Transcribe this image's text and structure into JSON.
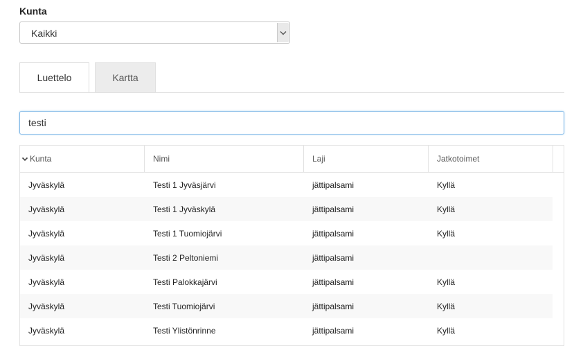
{
  "filter": {
    "label": "Kunta",
    "selected": "Kaikki"
  },
  "tabs": [
    {
      "label": "Luettelo",
      "active": true
    },
    {
      "label": "Kartta",
      "active": false
    }
  ],
  "search": {
    "value": "testi"
  },
  "table": {
    "columns": [
      "Kunta",
      "Nimi",
      "Laji",
      "Jatkotoimet"
    ],
    "rows": [
      [
        "Jyväskylä",
        "Testi 1 Jyväsjärvi",
        "jättipalsami",
        "Kyllä"
      ],
      [
        "Jyväskylä",
        "Testi 1 Jyväskylä",
        "jättipalsami",
        "Kyllä"
      ],
      [
        "Jyväskylä",
        "Testi 1 Tuomiojärvi",
        "jättipalsami",
        "Kyllä"
      ],
      [
        "Jyväskylä",
        "Testi 2 Peltoniemi",
        "jättipalsami",
        ""
      ],
      [
        "Jyväskylä",
        "Testi Palokkajärvi",
        "jättipalsami",
        "Kyllä"
      ],
      [
        "Jyväskylä",
        "Testi Tuomiojärvi",
        "jättipalsami",
        "Kyllä"
      ],
      [
        "Jyväskylä",
        "Testi Ylistönrinne",
        "jättipalsami",
        "Kyllä"
      ]
    ]
  },
  "icons": {
    "select_arrow": "chevron-down-icon",
    "sort": "sort-desc-icon"
  }
}
